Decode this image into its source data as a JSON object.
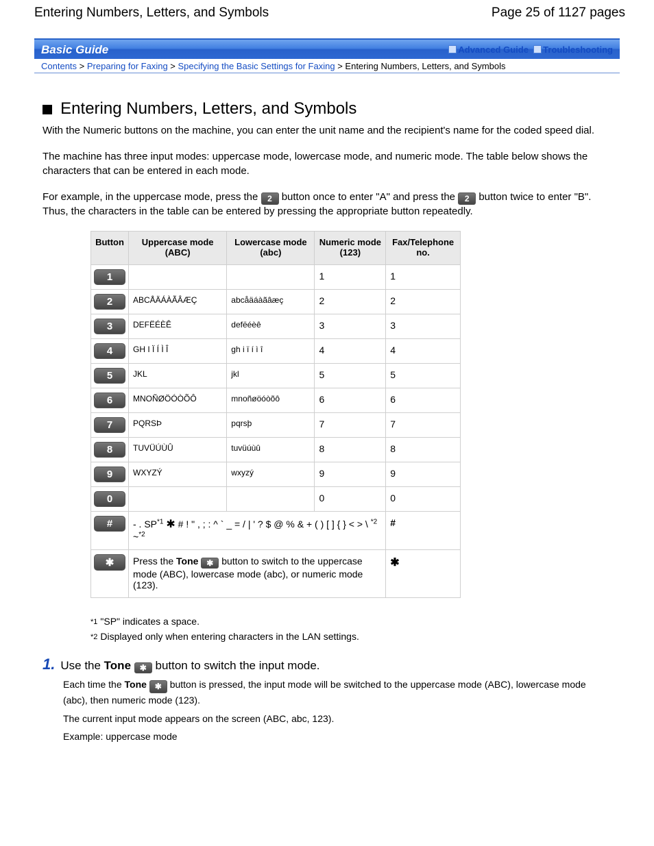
{
  "header": {
    "title": "Entering Numbers, Letters, and Symbols",
    "page_indicator": "Page 25 of 1127 pages"
  },
  "banner": {
    "title": "Basic Guide",
    "links": {
      "advanced": "Advanced Guide",
      "troubleshoot": "Troubleshooting"
    }
  },
  "crumbs": {
    "c1": "Contents",
    "c2": "Preparing for Faxing",
    "c3": "Specifying the Basic Settings for Faxing",
    "c4": "Entering Numbers, Letters, and Symbols",
    "sep": " > "
  },
  "article": {
    "heading": "Entering Numbers, Letters, and Symbols",
    "p1": "With the Numeric buttons on the machine, you can enter the unit name and the recipient's name for the coded speed dial.",
    "p2": "The machine has three input modes: uppercase mode, lowercase mode, and numeric mode. The table below shows the characters that can be entered in each mode.",
    "p3a": "For example, in the uppercase mode, press the ",
    "p3b": " button once to enter \"A\" and press the ",
    "p3c": " button twice to enter \"B\". Thus, the characters in the table can be entered by pressing the appropriate button repeatedly."
  },
  "table": {
    "headers": {
      "button": "Button",
      "upper": "Uppercase mode (ABC)",
      "lower": "Lowercase mode (abc)",
      "numeric": "Numeric mode (123)",
      "fax": "Fax/Telephone no."
    },
    "rows": [
      {
        "btn": "1",
        "upper": "",
        "lower": "",
        "num": "1",
        "fax": "1"
      },
      {
        "btn": "2",
        "upper": "ABCÅÄÁÀÃÂÆÇ",
        "lower": "abcåäáàãâæç",
        "num": "2",
        "fax": "2"
      },
      {
        "btn": "3",
        "upper": "DEFËÉÈÊ",
        "lower": "defëéèê",
        "num": "3",
        "fax": "3"
      },
      {
        "btn": "4",
        "upper": "GH I Ï Í Ì Î",
        "lower": "gh i ï í ì î",
        "num": "4",
        "fax": "4"
      },
      {
        "btn": "5",
        "upper": "JKL",
        "lower": "jkl",
        "num": "5",
        "fax": "5"
      },
      {
        "btn": "6",
        "upper": "MNOÑØÖÓÒÕÔ",
        "lower": "mnoñøöóòõô",
        "num": "6",
        "fax": "6"
      },
      {
        "btn": "7",
        "upper": "PQRSÞ",
        "lower": "pqrsþ",
        "num": "7",
        "fax": "7"
      },
      {
        "btn": "8",
        "upper": "TUVÜÚÙÛ",
        "lower": "tuvüúùû",
        "num": "8",
        "fax": "8"
      },
      {
        "btn": "9",
        "upper": "WXYZÝ",
        "lower": "wxyzý",
        "num": "9",
        "fax": "9"
      },
      {
        "btn": "0",
        "upper": "",
        "lower": "",
        "num": "0",
        "fax": "0"
      }
    ],
    "hashrow": {
      "btn": "#",
      "span_a": "- . SP",
      "span_b": "# ! \" , ; : ^ ` _ = / | ' ? $ @ % & + ( ) [ ] { } < > \\ ",
      "fax": "#"
    },
    "starrow": {
      "btn": "✱",
      "text_a": "Press the ",
      "text_b": " button to switch to the uppercase mode (ABC), lowercase mode (abc), or numeric mode (123).",
      "fax": "✱"
    }
  },
  "footnotes": {
    "f1": "\"SP\" indicates a space.",
    "f2": "Displayed only when entering characters in the LAN settings."
  },
  "step1": {
    "num": "1.",
    "line_a": "Use the ",
    "line_b": " button to switch the input mode.",
    "sub_a1": "Each time the ",
    "sub_a2": " button is pressed, the input mode will be switched to the uppercase mode (ABC), lowercase mode (abc), then numeric mode (123).",
    "sub_b": "The current input mode appears on the screen (ABC, abc, 123).",
    "sub_c": "Example: uppercase mode"
  },
  "labels": {
    "tone": "Tone",
    "two": "2",
    "star_small": "✱"
  }
}
